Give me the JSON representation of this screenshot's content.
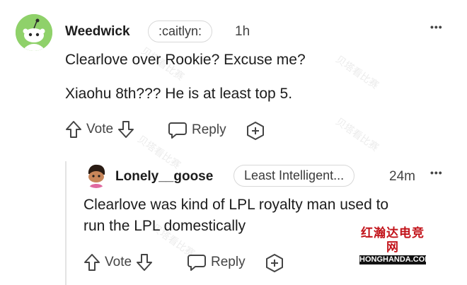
{
  "watermark_text": "贝塔看比赛",
  "site_badge": {
    "chinese": "红瀚达电竞网",
    "domain": "HONGHANDA.COM"
  },
  "comments": [
    {
      "username": "Weedwick",
      "flair": ":caitlyn:",
      "time": "1h",
      "lines": [
        "Clearlove over Rookie? Excuse me?",
        "Xiaohu 8th??? He is at least top 5."
      ],
      "vote_label": "Vote",
      "reply_label": "Reply",
      "more_label": "•••"
    },
    {
      "username": "Lonely__goose",
      "flair": "Least Intelligent...",
      "time": "24m",
      "lines": [
        "Clearlove was kind of LPL royalty man used to",
        "run the LPL domestically"
      ],
      "vote_label": "Vote",
      "reply_label": "Reply",
      "more_label": "•••"
    }
  ],
  "colors": {
    "avatar1_bg": "#8fd16a",
    "text": "#1c1c1c",
    "muted": "#444444",
    "thread_line": "#e3e3e3"
  }
}
